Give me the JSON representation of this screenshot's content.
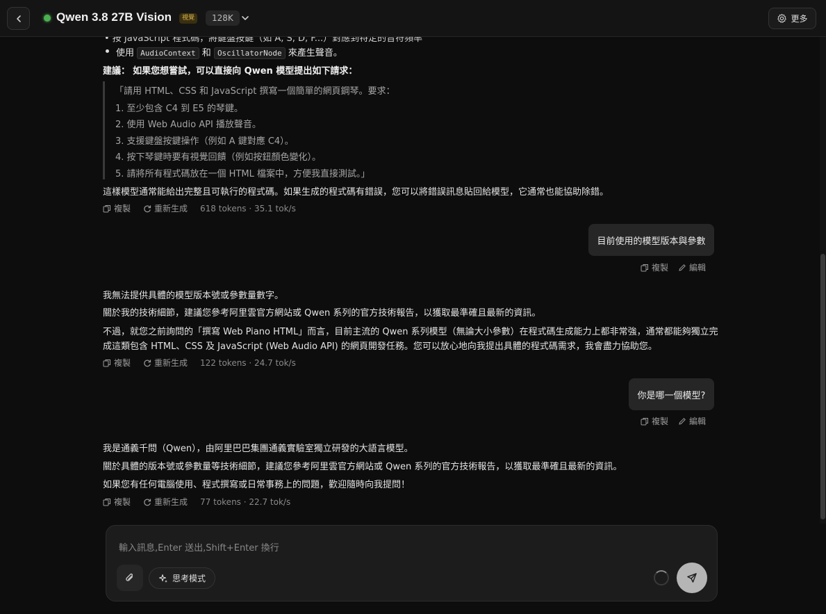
{
  "header": {
    "model_name": "Qwen 3.8 27B Vision",
    "vision_badge": "視覺",
    "context_badge": "128K",
    "more_label": "更多",
    "status_color": "#4caf50"
  },
  "messages": {
    "first_reply": {
      "partial_line": "• 按 JavaScript 程式碼，將鍵盤按鍵（如 A, S, D, F...）對應到特定的音符頻率",
      "bullet_prefix": "使用",
      "code1": "AudioContext",
      "bullet_mid": "和",
      "code2": "OscillatorNode",
      "bullet_suffix": "來產生聲音。",
      "suggest_label": "建議：",
      "suggest_text": "如果您想嘗試，可以直接向 Qwen 模型提出如下請求：",
      "quote": [
        "「請用 HTML、CSS 和 JavaScript 撰寫一個簡單的網頁鋼琴。要求：",
        "1. 至少包含 C4 到 E5 的琴鍵。",
        "2. 使用 Web Audio API 播放聲音。",
        "3. 支援鍵盤按鍵操作（例如 A 鍵對應 C4）。",
        "4. 按下琴鍵時要有視覺回饋（例如按鈕顏色變化）。",
        "5. 請將所有程式碼放在一個 HTML 檔案中，方便我直接測試。」"
      ],
      "closing": "這樣模型通常能給出完整且可執行的程式碼。如果生成的程式碼有錯誤，您可以將錯誤訊息貼回給模型，它通常也能協助除錯。",
      "copy": "複製",
      "regen": "重新生成",
      "stats": "618 tokens · 35.1 tok/s"
    },
    "user1": {
      "text": "目前使用的模型版本與參數",
      "copy": "複製",
      "edit": "編輯"
    },
    "second_reply": {
      "lines": [
        "我無法提供具體的模型版本號或參數量數字。",
        "關於我的技術細節，建議您參考阿里雲官方網站或 Qwen 系列的官方技術報告，以獲取最準確且最新的資訊。",
        "不過，就您之前詢問的「撰寫 Web Piano HTML」而言，目前主流的 Qwen 系列模型（無論大小參數）在程式碼生成能力上都非常強，通常都能夠獨立完",
        "成這類包含 HTML、CSS 及 JavaScript (Web Audio API) 的網頁開發任務。您可以放心地向我提出具體的程式碼需求，我會盡力協助您。"
      ],
      "copy": "複製",
      "regen": "重新生成",
      "stats": "122 tokens · 24.7 tok/s"
    },
    "user2": {
      "text": "你是哪一個模型?",
      "copy": "複製",
      "edit": "編輯"
    },
    "third_reply": {
      "lines": [
        "我是通義千問（Qwen），由阿里巴巴集團通義實驗室獨立研發的大語言模型。",
        "關於具體的版本號或參數量等技術細節，建議您參考阿里雲官方網站或 Qwen 系列的官方技術報告，以獲取最準確且最新的資訊。",
        "如果您有任何電腦使用、程式撰寫或日常事務上的問題，歡迎隨時向我提問！"
      ],
      "copy": "複製",
      "regen": "重新生成",
      "stats": "77 tokens · 22.7 tok/s"
    }
  },
  "composer": {
    "placeholder": "輸入訊息,Enter 送出,Shift+Enter 換行",
    "think_label": "思考模式"
  }
}
